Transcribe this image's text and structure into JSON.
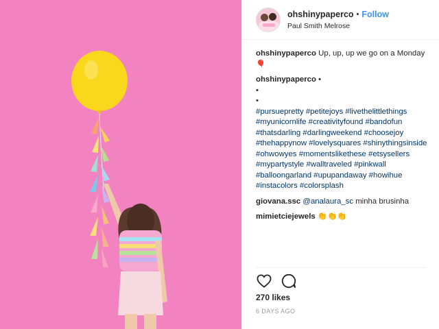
{
  "post": {
    "image": {
      "icon": "photo-pink-wall-yellow-balloon"
    },
    "header": {
      "username": "ohshinypaperco",
      "separator": "•",
      "follow_label": "Follow",
      "location": "Paul Smith Melrose"
    },
    "caption": {
      "username": "ohshinypaperco",
      "text": "Up, up, up we go on a Monday 🎈"
    },
    "hashtag_comment": {
      "username": "ohshinypaperco",
      "dot": "•",
      "lines": [
        "•",
        "•"
      ],
      "hashtags": [
        "#pursuepretty #petitejoys #livethelittlethings",
        "#myunicornlife #creativityfound #bandofun",
        "#thatsdarling #darlingweekend #choosejoy",
        "#thehappynow #lovelysquares",
        "#shinythingsinside #ohwowyes",
        "#momentslikethese #etsysellers #mypartystyle",
        "#walltraveled #pinkwall #balloongarland",
        "#upupandaway #howihue #instacolors",
        "#colorsplash"
      ]
    },
    "comments": [
      {
        "username": "giovana.ssc",
        "mention": "@analaura_sc",
        "text": "minha brusinha"
      },
      {
        "username": "mimietciejewels",
        "text": "👏👏👏"
      }
    ],
    "actions": {
      "like_icon": "heart-icon",
      "comment_icon": "comment-icon"
    },
    "likes": "270 likes",
    "date": "6 DAYS AGO"
  },
  "colors": {
    "link": "#3897f0",
    "hashtag": "#003569",
    "wall": "#f27fbe",
    "balloon": "#f9d71c"
  }
}
